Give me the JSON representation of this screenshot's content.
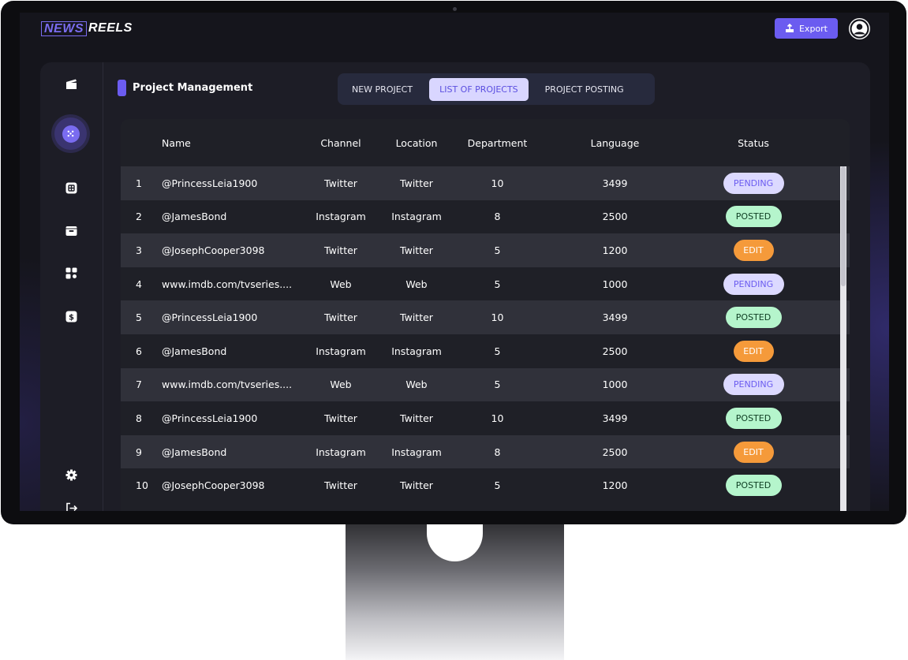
{
  "header": {
    "logo_news": "NEWS",
    "logo_reels": "REELS",
    "export_label": "Export"
  },
  "sidebar": {
    "items": [
      {
        "icon": "clapperboard-icon"
      },
      {
        "icon": "dots-grid-icon",
        "active": true
      },
      {
        "icon": "grid-box-icon"
      },
      {
        "icon": "folder-icon"
      },
      {
        "icon": "puzzle-icon"
      },
      {
        "icon": "dollar-icon"
      },
      {
        "icon": "gear-icon"
      },
      {
        "icon": "logout-icon"
      }
    ]
  },
  "main": {
    "title": "Project Management",
    "tabs": [
      {
        "label": "NEW PROJECT",
        "active": false
      },
      {
        "label": "LIST OF PROJECTS",
        "active": true
      },
      {
        "label": "PROJECT POSTING",
        "active": false
      }
    ],
    "table": {
      "columns": [
        "",
        "Name",
        "Channel",
        "Location",
        "Department",
        "Language",
        "Status"
      ],
      "rows": [
        {
          "no": "1",
          "name": "@PrincessLeia1900",
          "channel": "Twitter",
          "location": "Twitter",
          "department": "10",
          "language": "3499",
          "status": "PENDING"
        },
        {
          "no": "2",
          "name": "@JamesBond",
          "channel": "Instagram",
          "location": "Instagram",
          "department": "8",
          "language": "2500",
          "status": "POSTED"
        },
        {
          "no": "3",
          "name": "@JosephCooper3098",
          "channel": "Twitter",
          "location": "Twitter",
          "department": "5",
          "language": "1200",
          "status": "EDIT"
        },
        {
          "no": "4",
          "name": "www.imdb.com/tvseries....",
          "channel": "Web",
          "location": "Web",
          "department": "5",
          "language": "1000",
          "status": "PENDING"
        },
        {
          "no": "5",
          "name": "@PrincessLeia1900",
          "channel": "Twitter",
          "location": "Twitter",
          "department": "10",
          "language": "3499",
          "status": "POSTED"
        },
        {
          "no": "6",
          "name": "@JamesBond",
          "channel": "Instagram",
          "location": "Instagram",
          "department": "5",
          "language": "2500",
          "status": "EDIT"
        },
        {
          "no": "7",
          "name": "www.imdb.com/tvseries....",
          "channel": "Web",
          "location": "Web",
          "department": "5",
          "language": "1000",
          "status": "PENDING"
        },
        {
          "no": "8",
          "name": "@PrincessLeia1900",
          "channel": "Twitter",
          "location": "Twitter",
          "department": "10",
          "language": "3499",
          "status": "POSTED"
        },
        {
          "no": "9",
          "name": "@JamesBond",
          "channel": "Instagram",
          "location": "Instagram",
          "department": "8",
          "language": "2500",
          "status": "EDIT"
        },
        {
          "no": "10",
          "name": "@JosephCooper3098",
          "channel": "Twitter",
          "location": "Twitter",
          "department": "5",
          "language": "1200",
          "status": "POSTED"
        }
      ]
    }
  },
  "colors": {
    "accent": "#6b5cf0",
    "pending_bg": "#dcd9ff",
    "posted_bg": "#b5f5cc",
    "edit_bg": "#f59a3a"
  }
}
